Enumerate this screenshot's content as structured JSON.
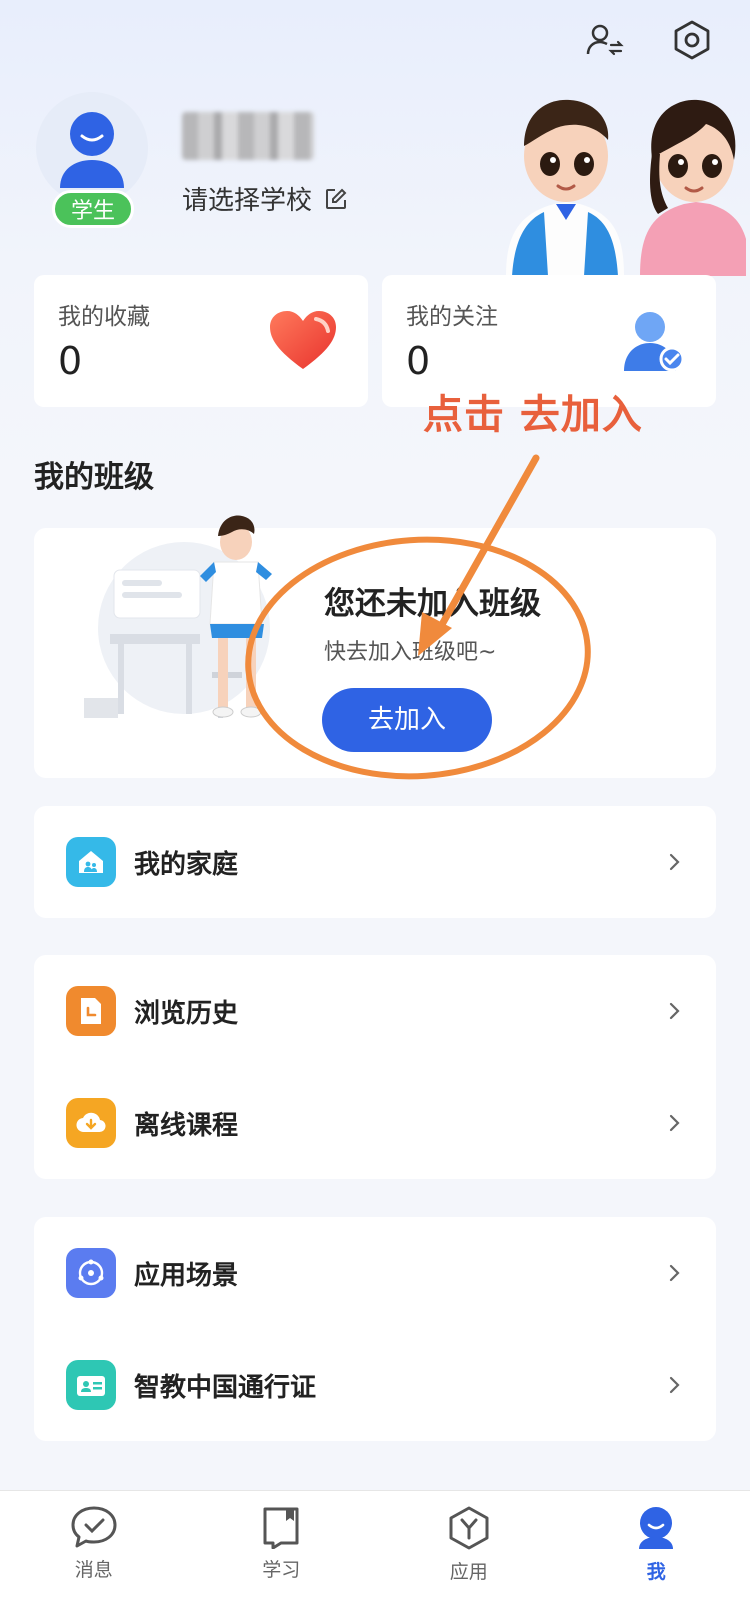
{
  "header": {
    "icons": [
      "switch-user-icon",
      "settings-icon"
    ]
  },
  "profile": {
    "role_badge": "学生",
    "school_prompt": "请选择学校"
  },
  "stats": [
    {
      "label": "我的收藏",
      "value": "0"
    },
    {
      "label": "我的关注",
      "value": "0"
    }
  ],
  "annotation": {
    "text": "点击 去加入"
  },
  "my_class": {
    "section_title": "我的班级",
    "empty_title": "您还未加入班级",
    "empty_subtitle": "快去加入班级吧~",
    "join_button": "去加入"
  },
  "menu_groups": [
    [
      {
        "label": "我的家庭",
        "icon": "family-home-icon",
        "color": "#35b9e8"
      }
    ],
    [
      {
        "label": "浏览历史",
        "icon": "history-doc-icon",
        "color": "#f08a2e"
      },
      {
        "label": "离线课程",
        "icon": "download-cloud-icon",
        "color": "#f5a623"
      }
    ],
    [
      {
        "label": "应用场景",
        "icon": "scenario-icon",
        "color": "#5b7cf0"
      },
      {
        "label": "智教中国通行证",
        "icon": "id-card-icon",
        "color": "#2ec7b4"
      }
    ]
  ],
  "tabs": [
    {
      "label": "消息",
      "icon": "message-icon",
      "active": false
    },
    {
      "label": "学习",
      "icon": "book-icon",
      "active": false
    },
    {
      "label": "应用",
      "icon": "apps-icon",
      "active": false
    },
    {
      "label": "我",
      "icon": "profile-icon",
      "active": true
    }
  ],
  "colors": {
    "accent": "#2f63e4",
    "annotation": "#f08a3c",
    "badge": "#4bc25a"
  }
}
